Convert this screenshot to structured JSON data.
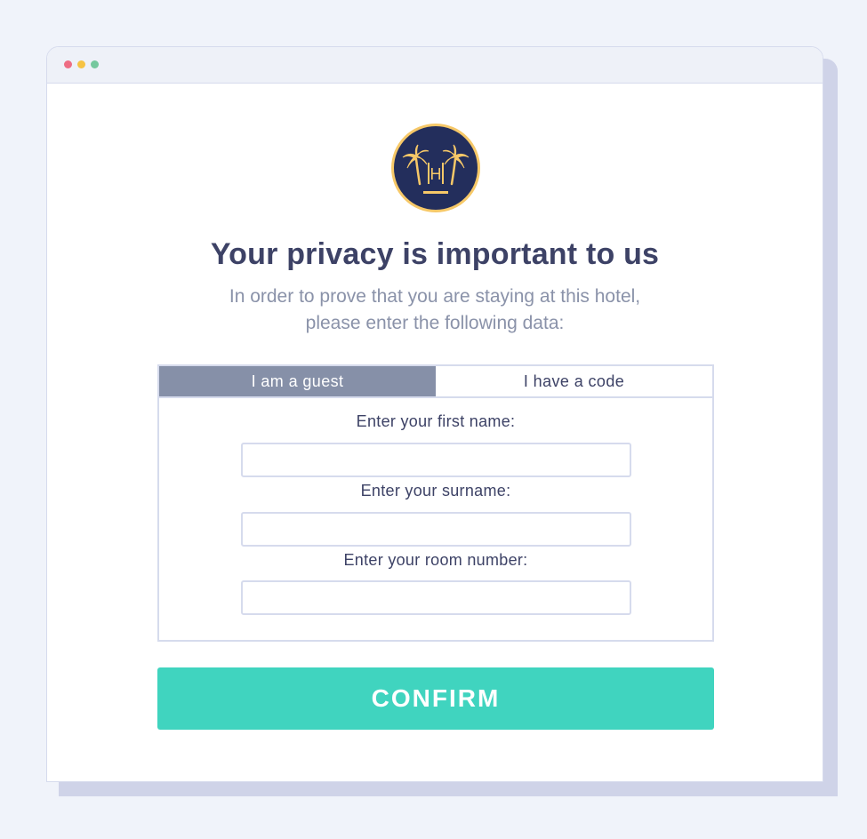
{
  "logo": {
    "letter": "H",
    "name": "hotel-palm-logo"
  },
  "heading": {
    "title": "Your privacy is important to us",
    "subtitle_line1": "In order to prove that you are staying at this hotel,",
    "subtitle_line2": "please enter the following data:"
  },
  "tabs": [
    {
      "label": "I am a guest",
      "active": true
    },
    {
      "label": "I have a code",
      "active": false
    }
  ],
  "form": {
    "first_name_label": "Enter your first name:",
    "first_name_value": "",
    "surname_label": "Enter your surname:",
    "surname_value": "",
    "room_label": "Enter your room number:",
    "room_value": ""
  },
  "confirm_label": "CONFIRM",
  "colors": {
    "accent": "#40d4bf",
    "active_tab": "#8690a8",
    "logo_bg": "#232e5c",
    "logo_gold": "#f6c868",
    "text_dark": "#3d4266",
    "text_muted": "#8a92a9"
  }
}
